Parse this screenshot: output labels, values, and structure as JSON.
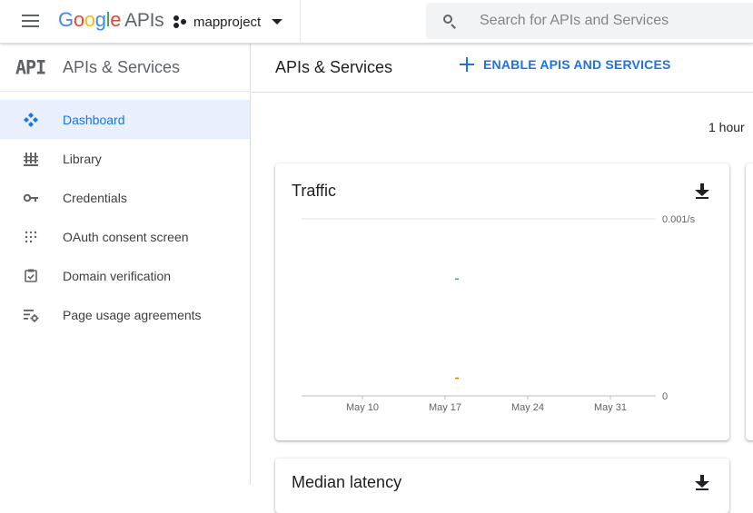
{
  "header": {
    "logo_letters": [
      "G",
      "o",
      "o",
      "g",
      "l",
      "e"
    ],
    "logo_suffix": "APIs",
    "project_name": "mapproject",
    "search_placeholder": "Search for APIs and Services"
  },
  "sidebar": {
    "logo_text": "API",
    "title": "APIs & Services",
    "items": [
      {
        "label": "Dashboard",
        "icon": "dashboard-icon",
        "active": true
      },
      {
        "label": "Library",
        "icon": "library-icon",
        "active": false
      },
      {
        "label": "Credentials",
        "icon": "key-icon",
        "active": false
      },
      {
        "label": "OAuth consent screen",
        "icon": "oauth-icon",
        "active": false
      },
      {
        "label": "Domain verification",
        "icon": "domain-check-icon",
        "active": false
      },
      {
        "label": "Page usage agreements",
        "icon": "settings-list-icon",
        "active": false
      }
    ]
  },
  "main": {
    "title": "APIs & Services",
    "enable_button": "ENABLE APIS AND SERVICES",
    "time_range": "1 hour",
    "cards": [
      {
        "title": "Traffic"
      },
      {
        "title": "Median latency"
      }
    ]
  },
  "colors": {
    "accent": "#1a73e8",
    "active_bg": "#e8f0fe",
    "series_blue": "#4285f4",
    "series_orange": "#e8710a"
  },
  "chart_data": {
    "type": "line",
    "title": "Traffic",
    "x_tick_labels": [
      "May 10",
      "May 17",
      "May 24",
      "May 31"
    ],
    "y_tick_labels": [
      "0.001/s",
      "0"
    ],
    "ylim": [
      0,
      0.001
    ],
    "series": [
      {
        "color": "#4285f4",
        "points": [
          {
            "x": "May 18",
            "y": 0.00066
          }
        ]
      },
      {
        "color": "#e8710a",
        "points": [
          {
            "x": "May 18",
            "y": 0.0001
          }
        ]
      }
    ],
    "grid": true
  }
}
